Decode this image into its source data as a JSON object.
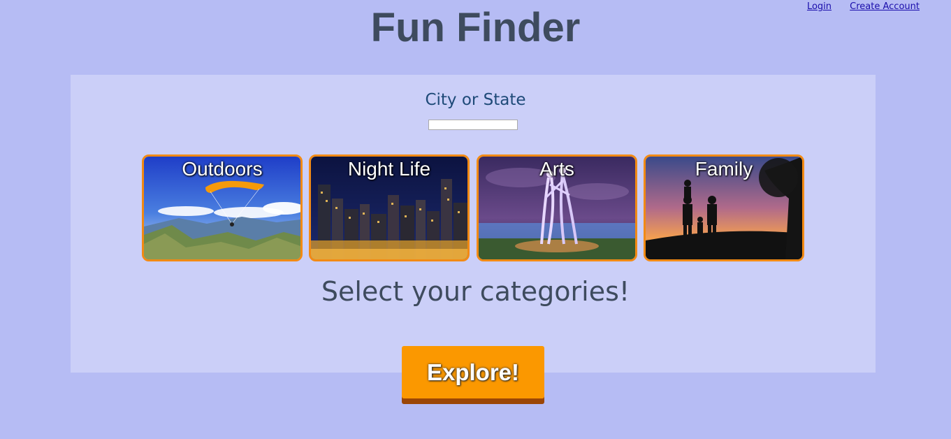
{
  "header": {
    "title": "Fun Finder",
    "links": {
      "login": "Login",
      "create_account": "Create Account"
    }
  },
  "search": {
    "label": "City or State",
    "value": "",
    "placeholder": ""
  },
  "categories": [
    {
      "label": "Outdoors",
      "image": "paraglider-mountains"
    },
    {
      "label": "Night Life",
      "image": "city-skyline-night"
    },
    {
      "label": "Arts",
      "image": "dancing-sculpture"
    },
    {
      "label": "Family",
      "image": "family-silhouette-sunset"
    }
  ],
  "prompt": "Select your categories!",
  "explore_button": "Explore!",
  "colors": {
    "background": "#b6bcf4",
    "panel": "#cbcff8",
    "tile_border": "#f28a14",
    "button": "#fb9800",
    "button_shadow": "#9b4606",
    "title": "#3e4b5e"
  }
}
